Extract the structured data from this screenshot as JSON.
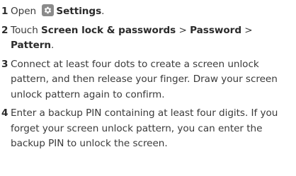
{
  "steps": [
    {
      "num": "1",
      "text_before": "Open",
      "icon": "settings-gear-icon",
      "bold": "Settings",
      "text_after": "."
    },
    {
      "num": "2",
      "text_before": "Touch",
      "bold1": "Screen lock & passwords",
      "sep1": " > ",
      "bold2": "Password",
      "sep2": " > ",
      "bold3": "Pattern",
      "text_after": "."
    },
    {
      "num": "3",
      "text": "Connect at least four dots to create a screen unlock pattern, and then release your finger. Draw your screen unlock pattern again to confirm."
    },
    {
      "num": "4",
      "text": "Enter a backup PIN containing at least four digits. If you forget your screen unlock pattern, you can enter the backup PIN to unlock the screen."
    }
  ],
  "colors": {
    "text": "#3a3a3a",
    "icon_bg": "#8a8a8a"
  }
}
